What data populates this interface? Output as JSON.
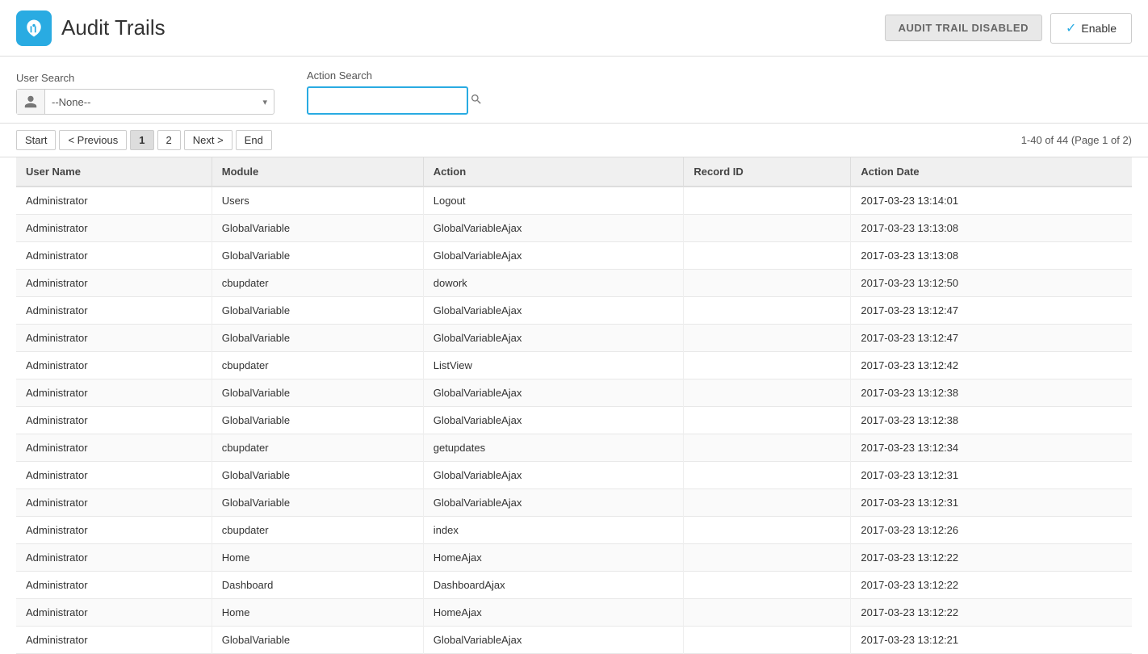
{
  "header": {
    "title": "Audit Trails",
    "audit_status_badge": "AUDIT TRAIL DISABLED",
    "enable_button_label": "Enable"
  },
  "search": {
    "user_search_label": "User Search",
    "user_search_value": "--None--",
    "action_search_label": "Action Search",
    "action_search_placeholder": ""
  },
  "pagination": {
    "start_label": "Start",
    "previous_label": "< Previous",
    "page1_label": "1",
    "page2_label": "2",
    "next_label": "Next >",
    "end_label": "End",
    "info": "1-40 of 44 (Page 1 of 2)"
  },
  "table": {
    "columns": [
      "User Name",
      "Module",
      "Action",
      "Record ID",
      "Action Date"
    ],
    "rows": [
      [
        "Administrator",
        "Users",
        "Logout",
        "",
        "2017-03-23 13:14:01"
      ],
      [
        "Administrator",
        "GlobalVariable",
        "GlobalVariableAjax",
        "",
        "2017-03-23 13:13:08"
      ],
      [
        "Administrator",
        "GlobalVariable",
        "GlobalVariableAjax",
        "",
        "2017-03-23 13:13:08"
      ],
      [
        "Administrator",
        "cbupdater",
        "dowork",
        "",
        "2017-03-23 13:12:50"
      ],
      [
        "Administrator",
        "GlobalVariable",
        "GlobalVariableAjax",
        "",
        "2017-03-23 13:12:47"
      ],
      [
        "Administrator",
        "GlobalVariable",
        "GlobalVariableAjax",
        "",
        "2017-03-23 13:12:47"
      ],
      [
        "Administrator",
        "cbupdater",
        "ListView",
        "",
        "2017-03-23 13:12:42"
      ],
      [
        "Administrator",
        "GlobalVariable",
        "GlobalVariableAjax",
        "",
        "2017-03-23 13:12:38"
      ],
      [
        "Administrator",
        "GlobalVariable",
        "GlobalVariableAjax",
        "",
        "2017-03-23 13:12:38"
      ],
      [
        "Administrator",
        "cbupdater",
        "getupdates",
        "",
        "2017-03-23 13:12:34"
      ],
      [
        "Administrator",
        "GlobalVariable",
        "GlobalVariableAjax",
        "",
        "2017-03-23 13:12:31"
      ],
      [
        "Administrator",
        "GlobalVariable",
        "GlobalVariableAjax",
        "",
        "2017-03-23 13:12:31"
      ],
      [
        "Administrator",
        "cbupdater",
        "index",
        "",
        "2017-03-23 13:12:26"
      ],
      [
        "Administrator",
        "Home",
        "HomeAjax",
        "",
        "2017-03-23 13:12:22"
      ],
      [
        "Administrator",
        "Dashboard",
        "DashboardAjax",
        "",
        "2017-03-23 13:12:22"
      ],
      [
        "Administrator",
        "Home",
        "HomeAjax",
        "",
        "2017-03-23 13:12:22"
      ],
      [
        "Administrator",
        "GlobalVariable",
        "GlobalVariableAjax",
        "",
        "2017-03-23 13:12:21"
      ]
    ]
  }
}
